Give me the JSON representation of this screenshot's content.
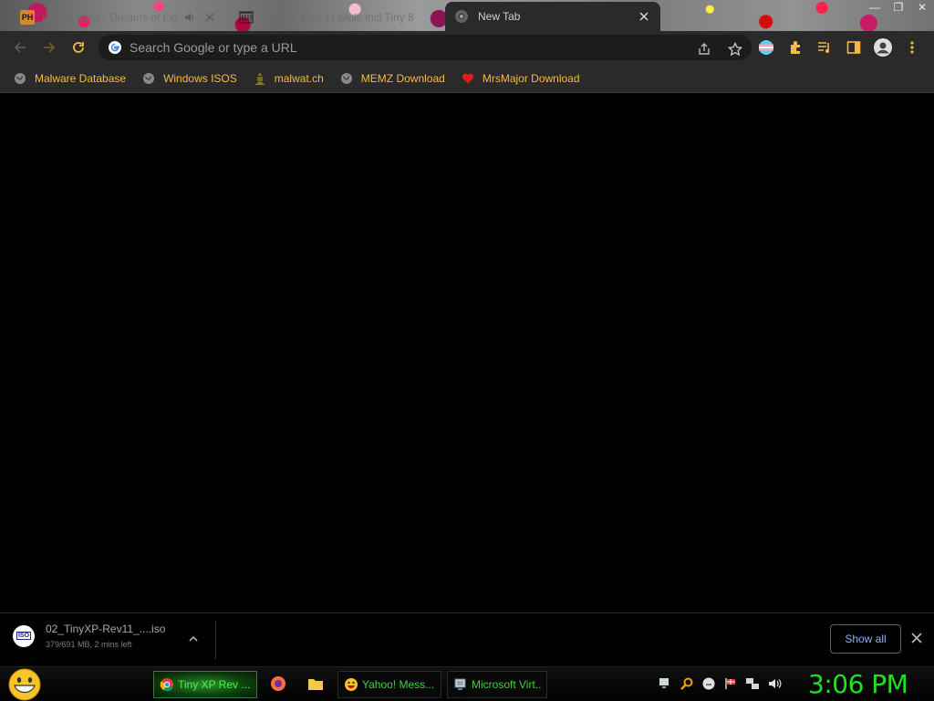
{
  "tabs": [
    {
      "title": "Hentai Misa - Dreams of Lig",
      "favicon": "PH",
      "active": false
    },
    {
      "title": "Tiny XP Rev 11 Multi Incl Tiny 8",
      "active": false
    },
    {
      "title": "New Tab",
      "active": true
    }
  ],
  "omnibox": {
    "placeholder": "Search Google or type a URL"
  },
  "bookmarks": [
    {
      "label": "Malware Database",
      "icon": "globe-icon"
    },
    {
      "label": "Windows ISOS",
      "icon": "globe-icon"
    },
    {
      "label": "malwat.ch",
      "icon": "malwatch-icon"
    },
    {
      "label": "MEMZ Download",
      "icon": "globe-icon"
    },
    {
      "label": "MrsMajor Download",
      "icon": "heart-icon"
    }
  ],
  "download": {
    "filename": "02_TinyXP-Rev11_....iso",
    "status": "379/691 MB, 2 mins left",
    "icon_text": "ISO",
    "show_all_label": "Show all"
  },
  "taskbar": {
    "tasks": [
      {
        "label": "Tiny XP Rev ...",
        "icon": "chrome-icon",
        "active": true
      },
      {
        "label": "Yahoo! Mess...",
        "icon": "yahoo-messenger-icon",
        "active": false
      },
      {
        "label": "Microsoft Virt...",
        "icon": "virtual-pc-icon",
        "active": false
      }
    ],
    "clock": "3:06 PM"
  },
  "colors": {
    "bookmark_text": "#f5b946",
    "taskbar_text": "#3fd23f",
    "clock": "#21e021",
    "link_blue": "#8ab4f8"
  }
}
